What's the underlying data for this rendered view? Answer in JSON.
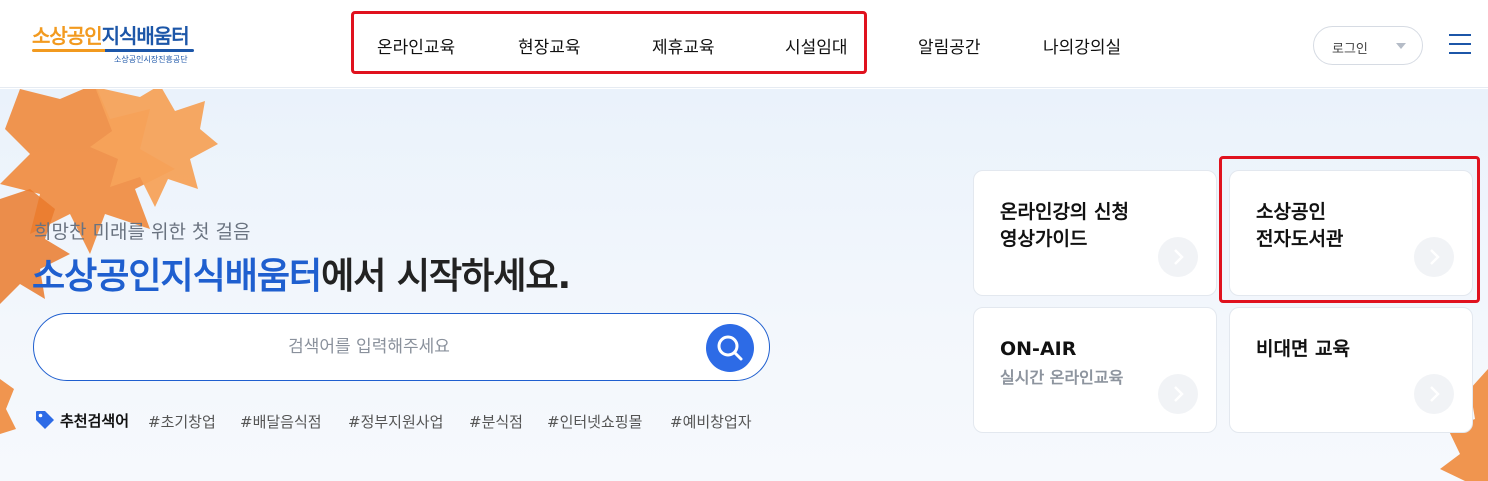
{
  "header": {
    "logo": {
      "main_orange": "소상공인",
      "main_blue": "지식배움터",
      "sub": "소상공인시장진흥공단"
    },
    "nav": [
      "온라인교육",
      "현장교육",
      "제휴교육",
      "시설임대",
      "알림공간",
      "나의강의실"
    ],
    "login_label": "로그인"
  },
  "hero": {
    "subtitle": "희망찬 미래를 위한 첫 걸음",
    "title_highlight": "소상공인지식배움터",
    "title_rest": "에서 시작하세요.",
    "search_placeholder": "검색어를 입력해주세요",
    "recommended_label": "추천검색어",
    "tags": [
      "#초기창업",
      "#배달음식점",
      "#정부지원사업",
      "#분식점",
      "#인터넷쇼핑몰",
      "#예비창업자"
    ]
  },
  "cards": [
    {
      "title_line1": "온라인강의 신청",
      "title_line2": "영상가이드"
    },
    {
      "title_line1": "소상공인",
      "title_line2": "전자도서관"
    },
    {
      "title_line1": "ON-AIR",
      "subtitle": "실시간 온라인교육"
    },
    {
      "title_line1": "비대면 교육"
    }
  ],
  "colors": {
    "brand_blue": "#1f5fcf",
    "brand_orange": "#f29a1f",
    "annotation_red": "#e0121e"
  }
}
